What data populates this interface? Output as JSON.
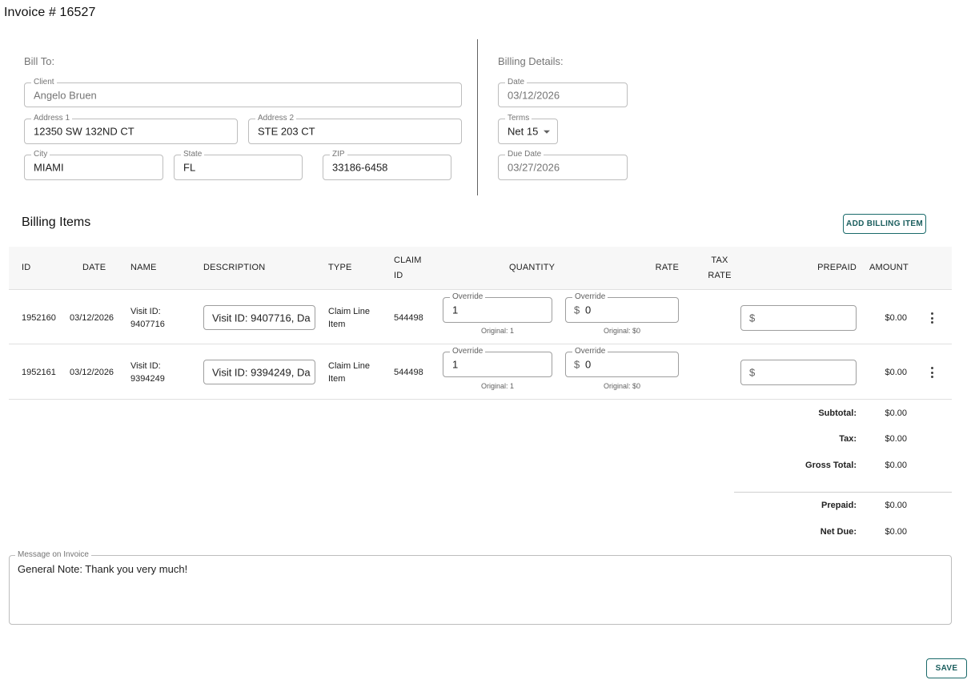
{
  "invoice_title": "Invoice # 16527",
  "bill_to": {
    "section_label": "Bill To:",
    "client": {
      "label": "Client",
      "value": "Angelo Bruen"
    },
    "address1": {
      "label": "Address 1",
      "value": "12350 SW 132ND CT"
    },
    "address2": {
      "label": "Address 2",
      "value": "STE 203 CT"
    },
    "city": {
      "label": "City",
      "value": "MIAMI"
    },
    "state": {
      "label": "State",
      "value": "FL"
    },
    "zip": {
      "label": "ZIP",
      "value": "33186-6458"
    }
  },
  "billing_details": {
    "section_label": "Billing Details:",
    "date": {
      "label": "Date",
      "value": "03/12/2026"
    },
    "terms": {
      "label": "Terms",
      "value": "Net 15"
    },
    "due_date": {
      "label": "Due Date",
      "value": "03/27/2026"
    }
  },
  "billing_items": {
    "heading": "Billing Items",
    "add_button": "ADD BILLING ITEM",
    "columns": {
      "id": "ID",
      "date": "DATE",
      "name": "NAME",
      "description": "DESCRIPTION",
      "type": "TYPE",
      "claim_id_1": "CLAIM",
      "claim_id_2": "ID",
      "quantity": "QUANTITY",
      "rate": "RATE",
      "tax_rate_1": "TAX",
      "tax_rate_2": "RATE",
      "prepaid": "PREPAID",
      "amount": "AMOUNT"
    },
    "rows": [
      {
        "id": "1952160",
        "date": "03/12/2026",
        "name_1": "Visit ID:",
        "name_2": "9407716",
        "description": "Visit ID: 9407716, Da",
        "type_1": "Claim Line",
        "type_2": "Item",
        "claim_id": "544498",
        "quantity_label": "Override",
        "quantity": "1",
        "quantity_original": "Original: 1",
        "rate_label": "Override",
        "rate_prefix": "$",
        "rate": "0",
        "rate_original": "Original: $0",
        "prepaid_prefix": "$",
        "amount": "$0.00"
      },
      {
        "id": "1952161",
        "date": "03/12/2026",
        "name_1": "Visit ID:",
        "name_2": "9394249",
        "description": "Visit ID: 9394249, Da",
        "type_1": "Claim Line",
        "type_2": "Item",
        "claim_id": "544498",
        "quantity_label": "Override",
        "quantity": "1",
        "quantity_original": "Original: 1",
        "rate_label": "Override",
        "rate_prefix": "$",
        "rate": "0",
        "rate_original": "Original: $0",
        "prepaid_prefix": "$",
        "amount": "$0.00"
      }
    ]
  },
  "totals": {
    "subtotal_label": "Subtotal:",
    "subtotal": "$0.00",
    "tax_label": "Tax:",
    "tax": "$0.00",
    "gross_label": "Gross Total:",
    "gross": "$0.00",
    "prepaid_label": "Prepaid:",
    "prepaid": "$0.00",
    "net_due_label": "Net Due:",
    "net_due": "$0.00"
  },
  "message": {
    "label": "Message on Invoice",
    "value": "General Note: Thank you very much!"
  },
  "save_button": "SAVE",
  "colors": {
    "accent": "#1a6a6a",
    "border": "#bdbdbd",
    "header_bg": "#f7f7f7"
  },
  "icons": {
    "row_menu": "more-vert-icon",
    "terms_dropdown": "caret-down-icon"
  }
}
